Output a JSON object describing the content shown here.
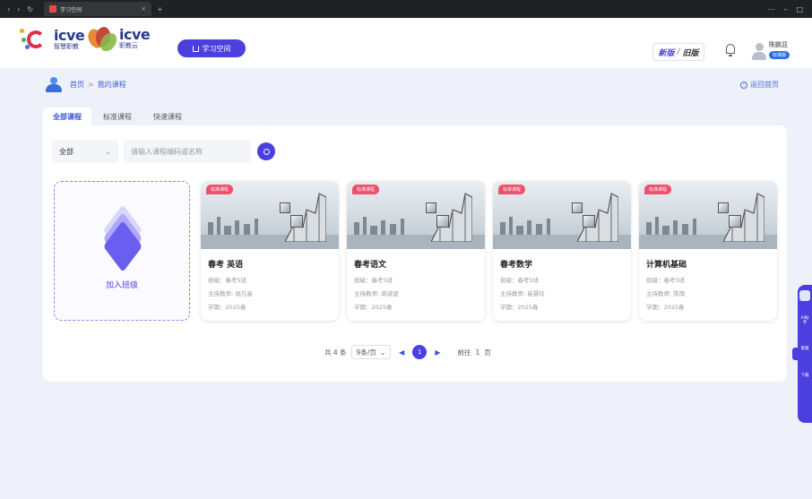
{
  "browser": {
    "tab_title": "学习空间",
    "tab_close": "×",
    "nav_icons": [
      "‹",
      "›",
      "↻"
    ],
    "newtab": "+",
    "window_controls": [
      "⋯",
      "–",
      "□"
    ]
  },
  "header": {
    "logo1_en": "icve",
    "logo1_cn": "智慧职教",
    "logo2_en": "icve",
    "logo2_cn": "职教云",
    "study_space": "学习空间",
    "version_new": "新版",
    "version_sep": "/",
    "version_old": "旧版",
    "user_name": "陈鹏显",
    "user_role": "标准版"
  },
  "breadcrumb": {
    "home": "首页",
    "sep": ">",
    "current": "我的课程",
    "back_home": "返回首页"
  },
  "tabs": [
    {
      "label": "全部课程",
      "active": true
    },
    {
      "label": "标准课程",
      "active": false
    },
    {
      "label": "快速课程",
      "active": false
    }
  ],
  "filter": {
    "select_value": "全部",
    "search_placeholder": "请输入课程编码或名称"
  },
  "join": {
    "label": "加入班级"
  },
  "courses": [
    {
      "tag": "标准课程",
      "title": "春考 英语",
      "class": "班级：春考5班",
      "teacher": "主持教师: 胡凡高",
      "term": "学期：2025春"
    },
    {
      "tag": "标准课程",
      "title": "春考语文",
      "class": "班级：春考5班",
      "teacher": "主持教师: 郭淑波",
      "term": "学期：2025春"
    },
    {
      "tag": "标准课程",
      "title": "春考数学",
      "class": "班级：春考5班",
      "teacher": "主持教师: 崔慧玲",
      "term": "学期：2025春"
    },
    {
      "tag": "标准课程",
      "title": "计算机基础",
      "class": "班级：春考5班",
      "teacher": "主持教师: 陈雨",
      "term": "学期：2025春"
    }
  ],
  "pagination": {
    "total": "共 4 条",
    "page_size": "9条/页",
    "current_page": "1",
    "goto_label": "前往",
    "goto_value": "1",
    "page_unit": "页"
  },
  "side_widget": {
    "items": [
      "AI助手",
      "客服",
      "下载"
    ]
  },
  "colors": {
    "primary": "#4b3fe0",
    "tag": "#ef4f6a",
    "link": "#3a55d6"
  }
}
